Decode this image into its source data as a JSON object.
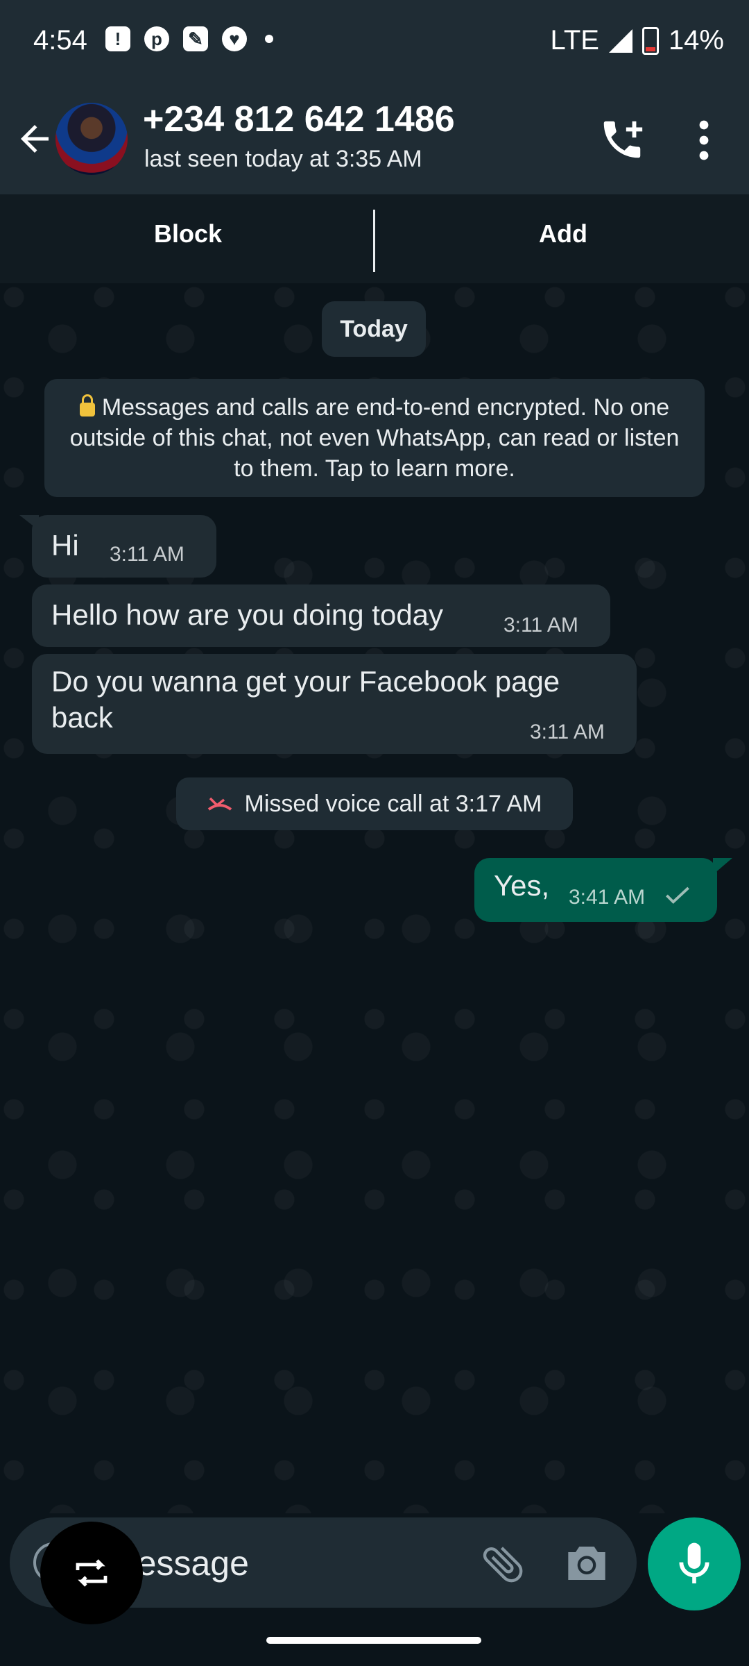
{
  "status_bar": {
    "time": "4:54",
    "network": "LTE",
    "battery": "14%",
    "icons": [
      "alert-icon",
      "pinterest-icon",
      "notes-icon",
      "heart-app-icon",
      "dot-icon",
      "signal-icon",
      "battery-icon"
    ]
  },
  "header": {
    "contact_name": "+234 812 642 1486",
    "last_seen": "last seen today at 3:35 AM",
    "icons": [
      "back-arrow-icon",
      "add-call-icon",
      "more-vert-icon"
    ]
  },
  "action_bar": {
    "block_label": "Block",
    "add_label": "Add"
  },
  "chat": {
    "date_label": "Today",
    "encryption_notice": "Messages and calls are end-to-end encrypted. No one outside of this chat, not even WhatsApp, can read or listen to them. Tap to learn more.",
    "messages": [
      {
        "direction": "in",
        "text": "Hi",
        "time": "3:11 AM"
      },
      {
        "direction": "in",
        "text": "Hello how are you doing today",
        "time": "3:11 AM"
      },
      {
        "direction": "in",
        "text": "Do you wanna get your Facebook page back",
        "time": "3:11 AM"
      },
      {
        "direction": "out",
        "text": "Yes,",
        "time": "3:41 AM",
        "status": "sent"
      }
    ],
    "missed_call": "Missed voice call at 3:17 AM"
  },
  "composer": {
    "placeholder": "Message",
    "icons": [
      "emoji-icon",
      "attach-icon",
      "camera-icon",
      "mic-icon"
    ]
  },
  "floating_button": {
    "icon": "repeat-icon"
  },
  "colors": {
    "background": "#0b141a",
    "header": "#1f2c34",
    "incoming_bubble": "#202c33",
    "outgoing_bubble": "#005c4b",
    "accent": "#00a884",
    "missed_call": "#f15c6d"
  }
}
